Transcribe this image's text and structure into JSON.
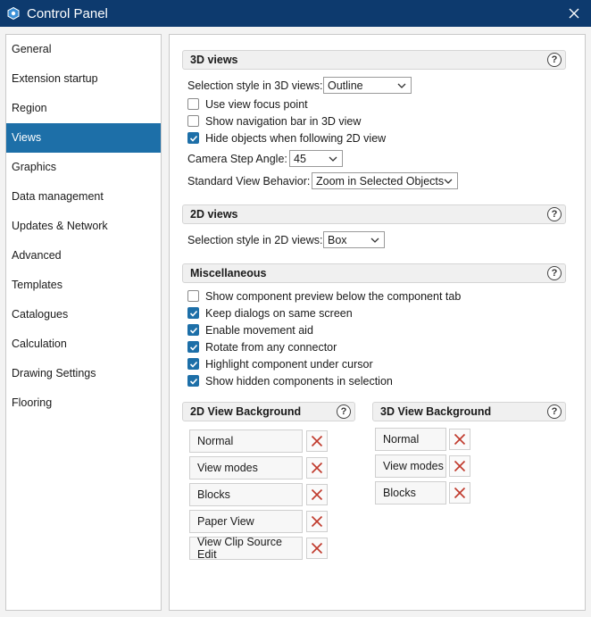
{
  "window": {
    "title": "Control Panel"
  },
  "sidebar": {
    "items": [
      {
        "label": "General"
      },
      {
        "label": "Extension startup"
      },
      {
        "label": "Region"
      },
      {
        "label": "Views",
        "active": true
      },
      {
        "label": "Graphics"
      },
      {
        "label": "Data management"
      },
      {
        "label": "Updates & Network"
      },
      {
        "label": "Advanced"
      },
      {
        "label": "Templates"
      },
      {
        "label": "Catalogues"
      },
      {
        "label": "Calculation"
      },
      {
        "label": "Drawing Settings"
      },
      {
        "label": "Flooring"
      }
    ]
  },
  "help_glyph": "?",
  "views3d": {
    "title": "3D views",
    "selection_label": "Selection style in 3D views:",
    "selection_value": "Outline",
    "options": [
      {
        "label": "Use view focus point",
        "checked": false
      },
      {
        "label": "Show navigation bar in 3D view",
        "checked": false
      },
      {
        "label": "Hide objects when following 2D view",
        "checked": true
      }
    ],
    "camera_label": "Camera Step Angle:",
    "camera_value": "45",
    "behavior_label": "Standard View Behavior:",
    "behavior_value": "Zoom in Selected Objects"
  },
  "views2d": {
    "title": "2D views",
    "selection_label": "Selection style in 2D views:",
    "selection_value": "Box"
  },
  "misc": {
    "title": "Miscellaneous",
    "options": [
      {
        "label": "Show component preview below the component tab",
        "checked": false
      },
      {
        "label": "Keep dialogs on same screen",
        "checked": true
      },
      {
        "label": "Enable movement aid",
        "checked": true
      },
      {
        "label": "Rotate from any connector",
        "checked": true
      },
      {
        "label": "Highlight component under cursor",
        "checked": true
      },
      {
        "label": "Show hidden components in selection",
        "checked": true
      }
    ]
  },
  "bg2d": {
    "title": "2D View Background",
    "items": [
      "Normal",
      "View modes",
      "Blocks",
      "Paper View",
      "View Clip Source Edit"
    ]
  },
  "bg3d": {
    "title": "3D View Background",
    "items": [
      "Normal",
      "View modes",
      "Blocks"
    ]
  },
  "colors": {
    "titlebar": "#0d3a6e",
    "accent": "#1d6fa8",
    "delete": "#c0392b"
  }
}
